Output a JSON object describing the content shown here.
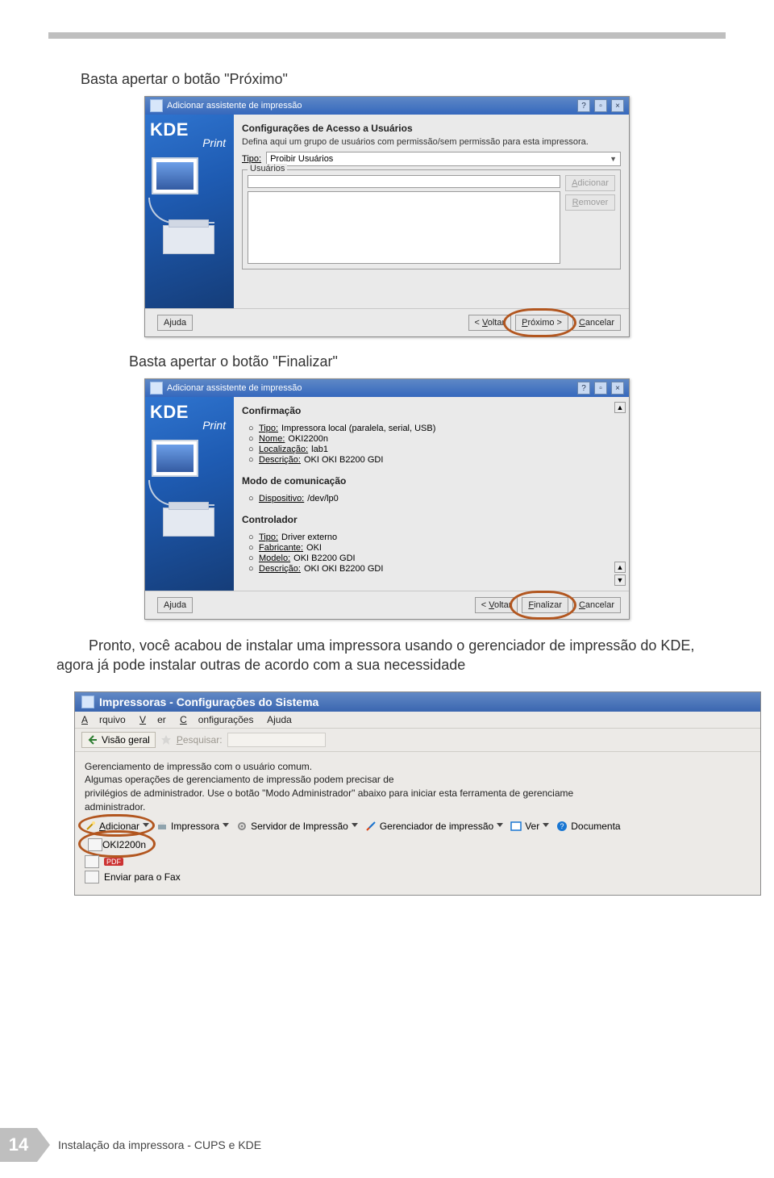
{
  "doc": {
    "text_proximo": "Basta apertar o botão \"Próximo\"",
    "text_finalizar": "Basta apertar o botão \"Finalizar\"",
    "para_conclusao": "Pronto, você acabou de instalar uma impressora usando o gerenciador de impressão do KDE, agora já pode instalar outras de acordo com a sua necessidade",
    "page_number": "14",
    "footer": "Instalação da impressora - CUPS e KDE"
  },
  "dialog1": {
    "title": "Adicionar assistente de impressão",
    "heading": "Configurações de Acesso a Usuários",
    "desc": "Defina aqui um grupo de usuários com permissão/sem permissão para esta impressora.",
    "tipo_label": "Tipo:",
    "tipo_value": "Proibir Usuários",
    "fieldset_legend": "Usuários",
    "btn_add": "Adicionar",
    "btn_remove": "Remover",
    "btn_help": "Ajuda",
    "btn_back": "< Voltar",
    "btn_next": "Próximo >",
    "btn_cancel": "Cancelar",
    "kde": "KDE",
    "kprint": "Print"
  },
  "dialog2": {
    "title": "Adicionar assistente de impressão",
    "heading": "Confirmação",
    "info": {
      "tipo_k": "Tipo:",
      "tipo_v": "Impressora local (paralela, serial, USB)",
      "nome_k": "Nome:",
      "nome_v": "OKI2200n",
      "loc_k": "Localização:",
      "loc_v": "lab1",
      "desc_k": "Descrição:",
      "desc_v": "OKI OKI B2200 GDI"
    },
    "comm_heading": "Modo de comunicação",
    "comm": {
      "disp_k": "Dispositivo:",
      "disp_v": "/dev/lp0"
    },
    "ctrl_heading": "Controlador",
    "ctrl": {
      "tipo_k": "Tipo:",
      "tipo_v": "Driver externo",
      "fab_k": "Fabricante:",
      "fab_v": "OKI",
      "mod_k": "Modelo:",
      "mod_v": "OKI B2200 GDI",
      "desc_k": "Descrição:",
      "desc_v": "OKI OKI B2200 GDI"
    },
    "btn_help": "Ajuda",
    "btn_back": "< Voltar",
    "btn_finish": "Finalizar",
    "btn_cancel": "Cancelar",
    "kde": "KDE",
    "kprint": "Print"
  },
  "app": {
    "title": "Impressoras - Configurações do Sistema",
    "menu": {
      "arquivo": "Arquivo",
      "ver": "Ver",
      "conf": "Configurações",
      "ajuda": "Ajuda"
    },
    "toolbar": {
      "visao": "Visão geral",
      "pesquisar": "Pesquisar:"
    },
    "msg1": "Gerenciamento de impressão com o usuário comum.",
    "msg2": "Algumas operações de gerenciamento de impressão podem precisar de",
    "msg3": " privilégios de administrador. Use o botão \"Modo Administrador\" abaixo para iniciar esta ferramenta de gerenciame",
    "msg4": "administrador.",
    "actions": {
      "adicionar": "Adicionar",
      "impressora": "Impressora",
      "servidor": "Servidor de Impressão",
      "gerenciador": "Gerenciador de impressão",
      "ver": "Ver",
      "doc": "Documenta"
    },
    "printers": {
      "p1": "OKI2200n",
      "p2": "PDF",
      "p3": "Enviar para o Fax"
    }
  }
}
